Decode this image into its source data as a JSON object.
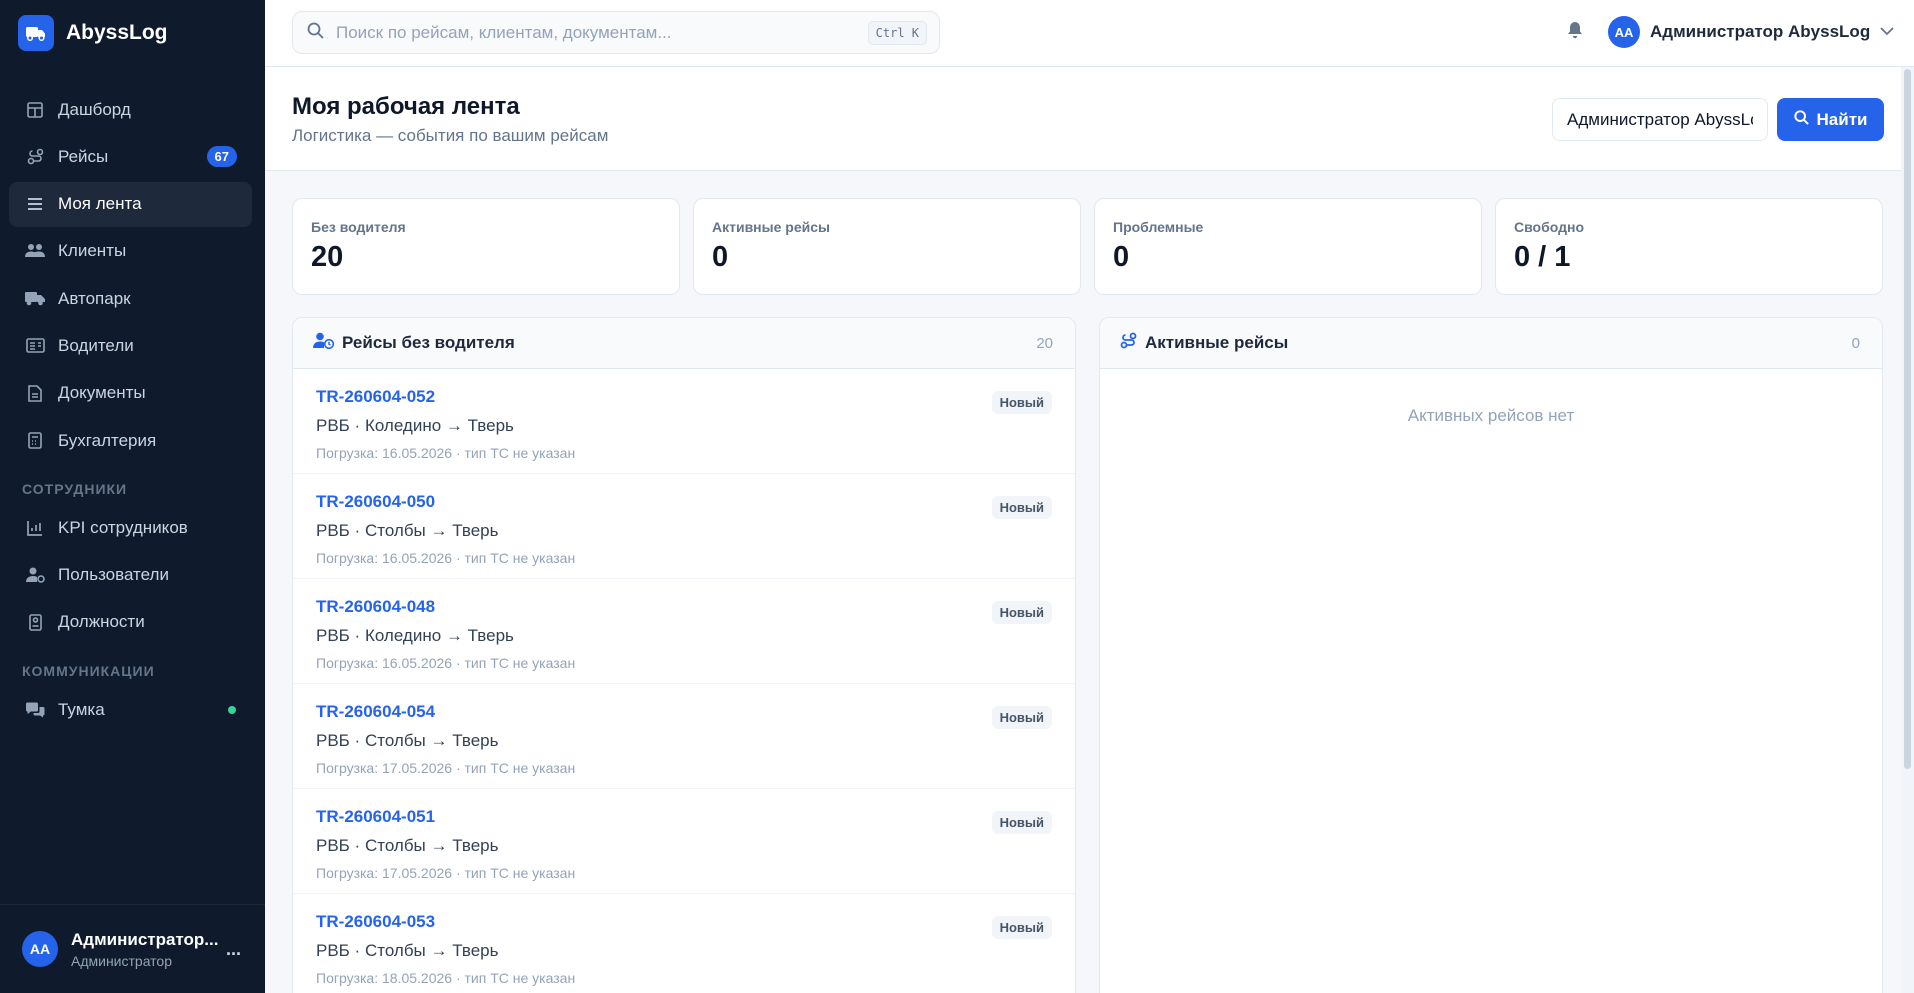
{
  "brand": {
    "name": "AbyssLog",
    "logo_icon": "truck-icon"
  },
  "sidebar": {
    "items": [
      {
        "label": "Дашборд",
        "icon": "grid-icon"
      },
      {
        "label": "Рейсы",
        "icon": "route-icon",
        "badge": "67"
      },
      {
        "label": "Моя лента",
        "icon": "list-icon",
        "active": true
      },
      {
        "label": "Клиенты",
        "icon": "users-icon"
      },
      {
        "label": "Автопарк",
        "icon": "truck-icon"
      },
      {
        "label": "Водители",
        "icon": "id-card-icon"
      },
      {
        "label": "Документы",
        "icon": "document-icon"
      },
      {
        "label": "Бухгалтерия",
        "icon": "calculator-icon"
      }
    ],
    "section_staff": "СОТРУДНИКИ",
    "staff_items": [
      {
        "label": "KPI сотрудников",
        "icon": "bar-chart-icon"
      },
      {
        "label": "Пользователи",
        "icon": "user-cog-icon"
      },
      {
        "label": "Должности",
        "icon": "badge-icon"
      }
    ],
    "section_comm": "КОММУНИКАЦИИ",
    "comm_items": [
      {
        "label": "Тумка",
        "icon": "chat-icon",
        "online": true
      }
    ],
    "footer": {
      "avatar": "AA",
      "name": "Администратор...",
      "role": "Администратор",
      "more": "..."
    }
  },
  "topbar": {
    "search_placeholder": "Поиск по рейсам, клиентам, документам...",
    "shortcut": "Ctrl K",
    "user_avatar": "AA",
    "user_name": "Администратор AbyssLog"
  },
  "page": {
    "title": "Моя рабочая лента",
    "subtitle": "Логистика — события по вашим рейсам",
    "filter_value": "Администратор AbyssLog",
    "search_button": "Найти"
  },
  "stats": [
    {
      "label": "Без водителя",
      "value": "20"
    },
    {
      "label": "Активные рейсы",
      "value": "0"
    },
    {
      "label": "Проблемные",
      "value": "0"
    },
    {
      "label": "Свободно",
      "value": "0 / 1"
    }
  ],
  "panel_unassigned": {
    "title": "Рейсы без водителя",
    "count": "20",
    "trips": [
      {
        "id": "TR-260604-052",
        "route": "РВБ · Коледино → Тверь",
        "meta": "Погрузка: 16.05.2026 · тип ТС не указан",
        "status": "Новый"
      },
      {
        "id": "TR-260604-050",
        "route": "РВБ · Столбы → Тверь",
        "meta": "Погрузка: 16.05.2026 · тип ТС не указан",
        "status": "Новый"
      },
      {
        "id": "TR-260604-048",
        "route": "РВБ · Коледино → Тверь",
        "meta": "Погрузка: 16.05.2026 · тип ТС не указан",
        "status": "Новый"
      },
      {
        "id": "TR-260604-054",
        "route": "РВБ · Столбы → Тверь",
        "meta": "Погрузка: 17.05.2026 · тип ТС не указан",
        "status": "Новый"
      },
      {
        "id": "TR-260604-051",
        "route": "РВБ · Столбы → Тверь",
        "meta": "Погрузка: 17.05.2026 · тип ТС не указан",
        "status": "Новый"
      },
      {
        "id": "TR-260604-053",
        "route": "РВБ · Столбы → Тверь",
        "meta": "Погрузка: 18.05.2026 · тип ТС не указан",
        "status": "Новый"
      }
    ]
  },
  "panel_active": {
    "title": "Активные рейсы",
    "count": "0",
    "empty": "Активных рейсов нет"
  },
  "colors": {
    "accent": "#2563eb",
    "sidebar": "#0f1b2d",
    "online": "#34d399"
  }
}
